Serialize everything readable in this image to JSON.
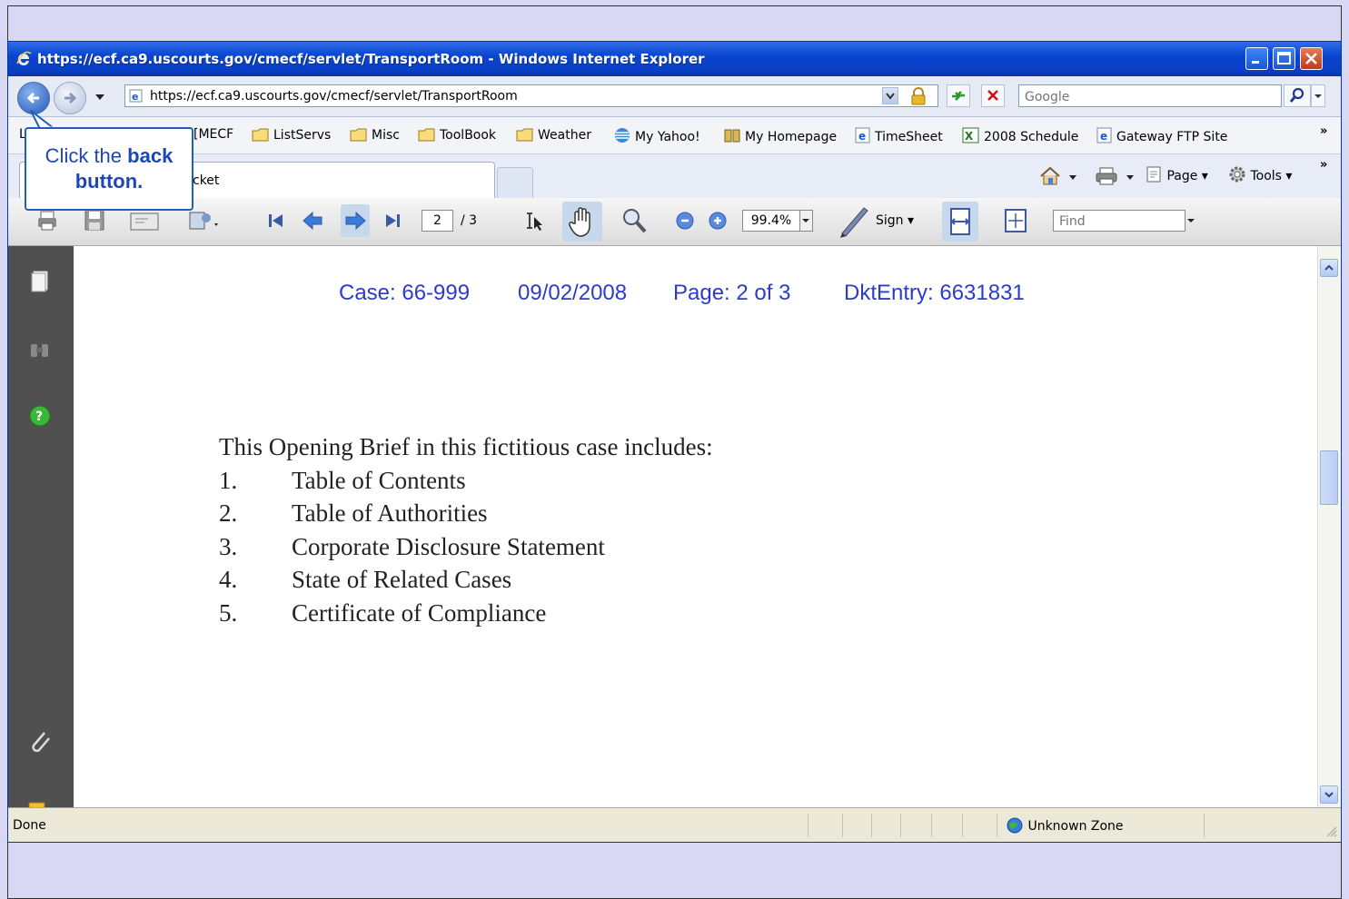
{
  "window": {
    "title": "https://ecf.ca9.uscourts.gov/cmecf/servlet/TransportRoom - Windows Internet Explorer"
  },
  "address_bar": {
    "url": "https://ecf.ca9.uscourts.gov/cmecf/servlet/TransportRoom",
    "search_placeholder": "Google"
  },
  "links": [
    {
      "label": "L"
    },
    {
      "label": "[MECF"
    },
    {
      "label": "ListServs",
      "icon": "folder-icon"
    },
    {
      "label": "Misc",
      "icon": "folder-icon"
    },
    {
      "label": "ToolBook",
      "icon": "folder-icon"
    },
    {
      "label": "Weather",
      "icon": "folder-icon"
    },
    {
      "label": "My Yahoo!",
      "icon": "att-icon"
    },
    {
      "label": "My Homepage",
      "icon": "book-icon"
    },
    {
      "label": "TimeSheet",
      "icon": "ie-page-icon"
    },
    {
      "label": "2008 Schedule",
      "icon": "excel-icon"
    },
    {
      "label": "Gateway FTP Site",
      "icon": "ie-page-icon"
    }
  ],
  "tabs": {
    "active_tab_label": "cket"
  },
  "command_bar": {
    "page_label": "Page",
    "tools_label": "Tools"
  },
  "pdf_toolbar": {
    "current_page": "2",
    "total_pages": "/ 3",
    "zoom": "99.4%",
    "sign_label": "Sign",
    "find_placeholder": "Find"
  },
  "document": {
    "header": {
      "case": "Case: 66-999",
      "date": "09/02/2008",
      "page": "Page: 2 of 3",
      "dkt": "DktEntry: 6631831"
    },
    "intro": "This Opening Brief in this fictitious case includes:",
    "items": [
      {
        "num": "1.",
        "text": "Table of Contents"
      },
      {
        "num": "2.",
        "text": "Table of Authorities"
      },
      {
        "num": "3.",
        "text": "Corporate Disclosure Statement"
      },
      {
        "num": "4.",
        "text": "State of Related Cases"
      },
      {
        "num": "5.",
        "text": "Certificate of Compliance"
      }
    ]
  },
  "status_bar": {
    "status": "Done",
    "zone": "Unknown Zone"
  },
  "callout": {
    "line1_plain": "Click the ",
    "line1_bold": "back",
    "line2": "button."
  },
  "colors": {
    "titlebar": "#0a45d0",
    "header_text": "#2c3cc8",
    "callout_border": "#1f5fb8"
  }
}
